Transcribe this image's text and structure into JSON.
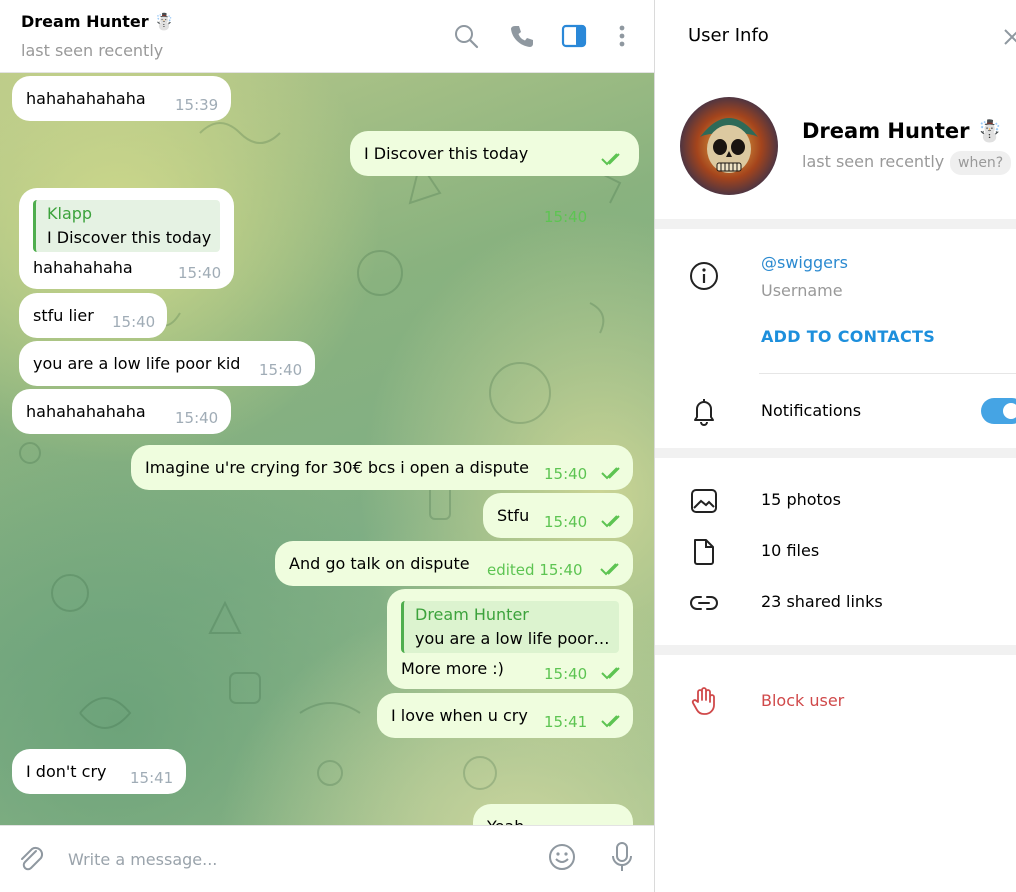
{
  "chat": {
    "title": "Dream Hunter ☃️",
    "status": "last seen recently",
    "messages": [
      {
        "dir": "in",
        "text": "hahahahahaha",
        "time": "15:39"
      },
      {
        "dir": "out",
        "text": "I Discover this today",
        "time": "15:40"
      },
      {
        "dir": "in",
        "reply_name": "Klapp",
        "reply_text": "I Discover this today",
        "text": "hahahahaha",
        "time": "15:40"
      },
      {
        "dir": "in",
        "text": "stfu lier",
        "time": "15:40"
      },
      {
        "dir": "in",
        "text": "you are a low life poor kid",
        "time": "15:40"
      },
      {
        "dir": "in",
        "text": "hahahahahaha",
        "time": "15:40"
      },
      {
        "dir": "out",
        "text": "Imagine u're crying for 30€ bcs i open a dispute",
        "time": "15:40"
      },
      {
        "dir": "out",
        "text": "Stfu",
        "time": "15:40"
      },
      {
        "dir": "out",
        "text": "And go talk on dispute",
        "time": "edited 15:40"
      },
      {
        "dir": "out",
        "reply_name": "Dream Hunter",
        "reply_text": "you are a low life poor…",
        "text": "More more :)",
        "time": "15:40"
      },
      {
        "dir": "out",
        "text": "I love when u cry",
        "time": "15:41"
      },
      {
        "dir": "in",
        "text": "I don't cry",
        "time": "15:41"
      },
      {
        "dir": "out",
        "text": "Yeah",
        "time": ""
      }
    ]
  },
  "composer": {
    "placeholder": "Write a message..."
  },
  "icons": {
    "search": "search-icon",
    "call": "phone-icon",
    "sidebar": "sidebar-toggle-icon",
    "more": "more-vertical-icon",
    "attach": "paperclip-icon",
    "emoji": "emoji-icon",
    "mic": "microphone-icon",
    "close": "close-icon",
    "info": "info-icon",
    "bell": "bell-icon",
    "photos": "photo-icon",
    "files": "file-icon",
    "links": "link-icon",
    "block": "hand-icon"
  },
  "colors": {
    "accent": "#2b8ad0",
    "outgoing": "#effdde",
    "incoming": "#ffffff",
    "danger": "#d0494a",
    "check": "#5dc452"
  },
  "panel": {
    "title": "User Info",
    "name": "Dream Hunter ☃️",
    "status": "last seen recently",
    "when": "when?",
    "username": "@swiggers",
    "username_label": "Username",
    "add_contacts": "ADD TO CONTACTS",
    "notifications_label": "Notifications",
    "notifications_on": true,
    "photos": "15 photos",
    "files": "10 files",
    "links": "23 shared links",
    "block": "Block user"
  }
}
